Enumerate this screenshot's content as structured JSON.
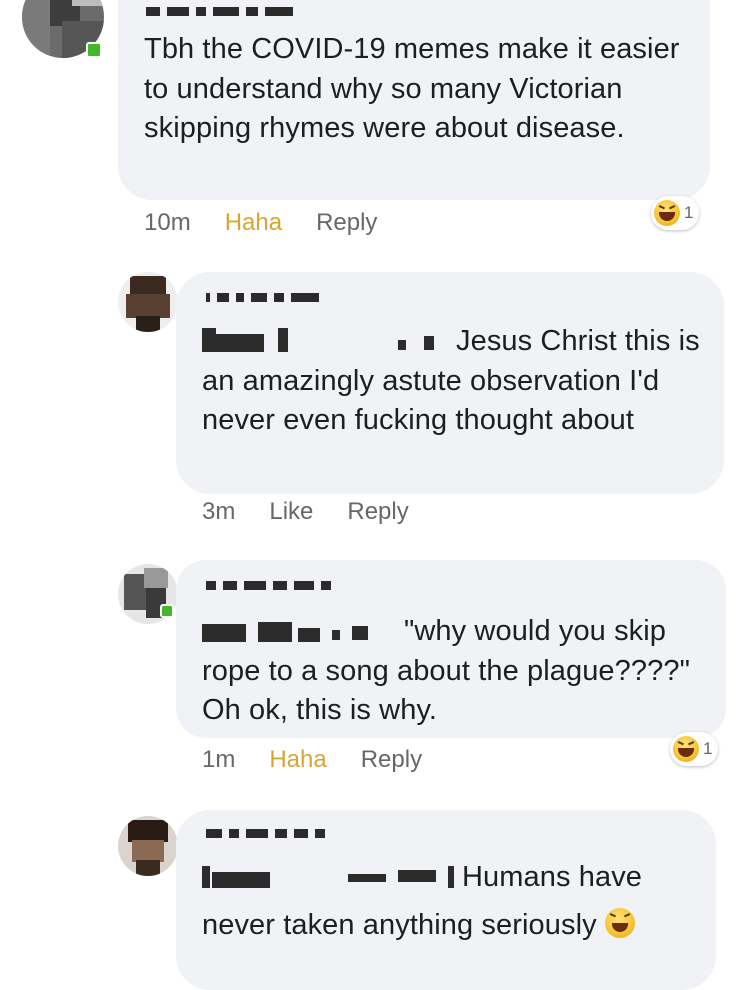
{
  "comments": [
    {
      "text": "Tbh the COVID-19 memes make it easier to understand why so many Victorian skipping rhymes were about disease.",
      "time": "10m",
      "action": "Haha",
      "reply": "Reply",
      "reaction_icon": "laughing-emoji-icon",
      "reaction_count": "1"
    },
    {
      "text": "Jesus Christ this is an amazingly astute observation I'd never even fucking thought about",
      "time": "3m",
      "action": "Like",
      "reply": "Reply"
    },
    {
      "text": "\"why would you skip rope to a song about the plague????\" Oh ok, this is why.",
      "time": "1m",
      "action": "Haha",
      "reply": "Reply",
      "reaction_icon": "laughing-emoji-icon",
      "reaction_count": "1"
    },
    {
      "text_line1": "Humans have",
      "text_line2": "never taken anything seriously",
      "trailing_emoji": "tears-of-joy-emoji-icon"
    }
  ],
  "colors": {
    "bubble": "#f0f2f5",
    "text": "#1c1e21",
    "meta": "#65676b",
    "haha": "#d7a532",
    "online": "#42b72a"
  }
}
